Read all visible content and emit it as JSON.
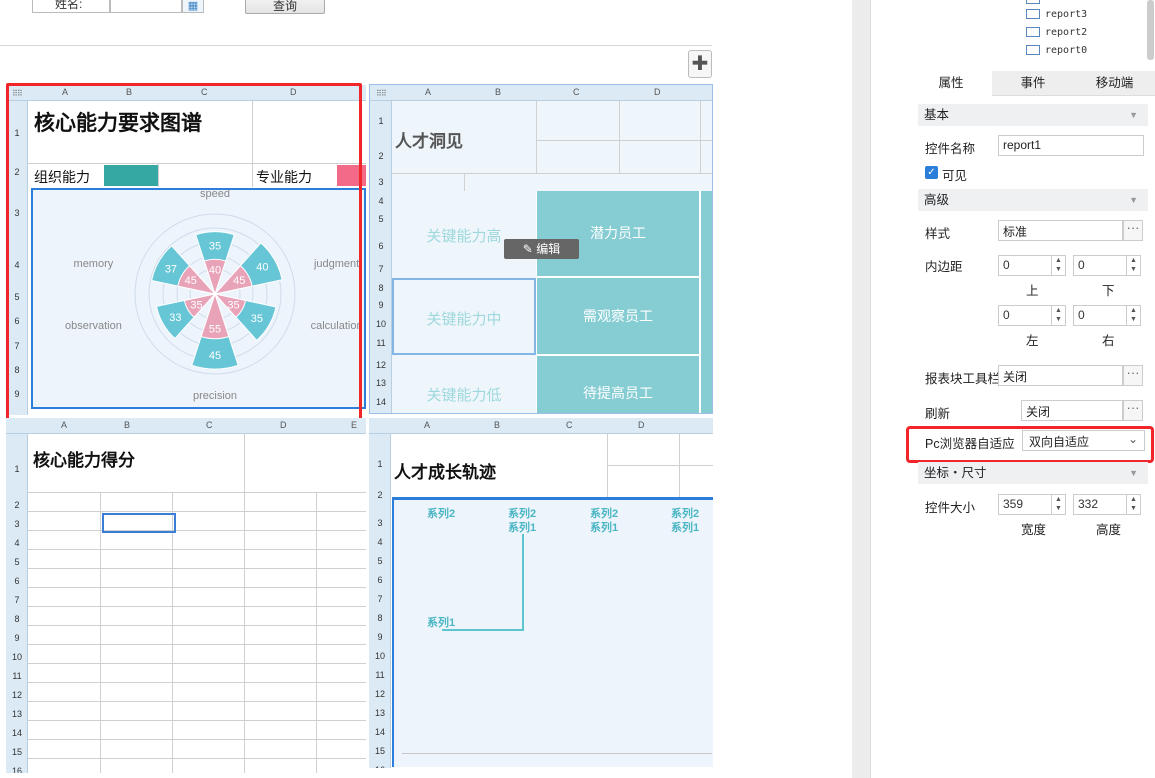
{
  "toolbar": {
    "name_label": "姓名:",
    "query_label": "查询"
  },
  "block1": {
    "cols": [
      "A",
      "B",
      "C",
      "D"
    ],
    "rows": [
      "1",
      "2",
      "3",
      "4",
      "5",
      "6",
      "7",
      "8",
      "9"
    ],
    "title": "核心能力要求图谱",
    "org_label": "组织能力",
    "pro_label": "专业能力",
    "colors": {
      "teal": "#36a8a4",
      "pink": "#f36a88"
    }
  },
  "chart_data": {
    "type": "polar-bar",
    "categories": [
      "speed",
      "judgment",
      "calculation",
      "precision",
      "observation",
      "memory"
    ],
    "series": [
      {
        "values": [
          35,
          40,
          35,
          45,
          33,
          37
        ],
        "color": "#67c6d6"
      },
      {
        "values": [
          40,
          45,
          35,
          55,
          35,
          45
        ],
        "color": "#e8a3b8"
      }
    ]
  },
  "block2": {
    "cols": [
      "A",
      "B",
      "C",
      "D"
    ],
    "rows": [
      "1",
      "2",
      "3",
      "4",
      "5",
      "6",
      "7",
      "8",
      "9",
      "10",
      "11",
      "12",
      "13",
      "14"
    ],
    "title": "人才洞见",
    "row_labels": [
      "关键能力高",
      "关键能力中",
      "关键能力低"
    ],
    "cells": [
      "潜力员工",
      "需观察员工",
      "待提高员工"
    ],
    "edit_label": "编辑"
  },
  "block3": {
    "cols": [
      "A",
      "B",
      "C",
      "D",
      "E"
    ],
    "rows": [
      "1",
      "2",
      "3",
      "4",
      "5",
      "6",
      "7",
      "8",
      "9",
      "10",
      "11",
      "12",
      "13",
      "14",
      "15",
      "16"
    ],
    "title": "核心能力得分"
  },
  "block4": {
    "cols": [
      "A",
      "B",
      "C",
      "D"
    ],
    "rows": [
      "1",
      "2",
      "3",
      "4",
      "5",
      "6",
      "7",
      "8",
      "9",
      "10",
      "11",
      "12",
      "13",
      "14",
      "15",
      "16"
    ],
    "title": "人才成长轨迹",
    "series2": "系列2",
    "series1": "系列1"
  },
  "panel": {
    "tree": [
      "report3",
      "report2",
      "report0"
    ],
    "tabs": [
      "属性",
      "事件",
      "移动端"
    ],
    "sec_basic": "基本",
    "name_label": "控件名称",
    "name_value": "report1",
    "visible_label": "可见",
    "sec_advanced": "高级",
    "style_label": "样式",
    "style_value": "标准",
    "padding_label": "内边距",
    "pad_top": "0",
    "pad_bottom": "0",
    "pad_left": "0",
    "pad_right": "0",
    "top": "上",
    "bottom": "下",
    "left": "左",
    "right": "右",
    "toolbar_label": "报表块工具栏",
    "toolbar_value": "关闭",
    "refresh_label": "刷新",
    "refresh_value": "关闭",
    "adapt_label": "Pc浏览器自适应",
    "adapt_value": "双向自适应",
    "sec_coord": "坐标・尺寸",
    "size_label": "控件大小",
    "width_value": "359",
    "height_value": "332",
    "width_label": "宽度",
    "height_label": "高度"
  }
}
